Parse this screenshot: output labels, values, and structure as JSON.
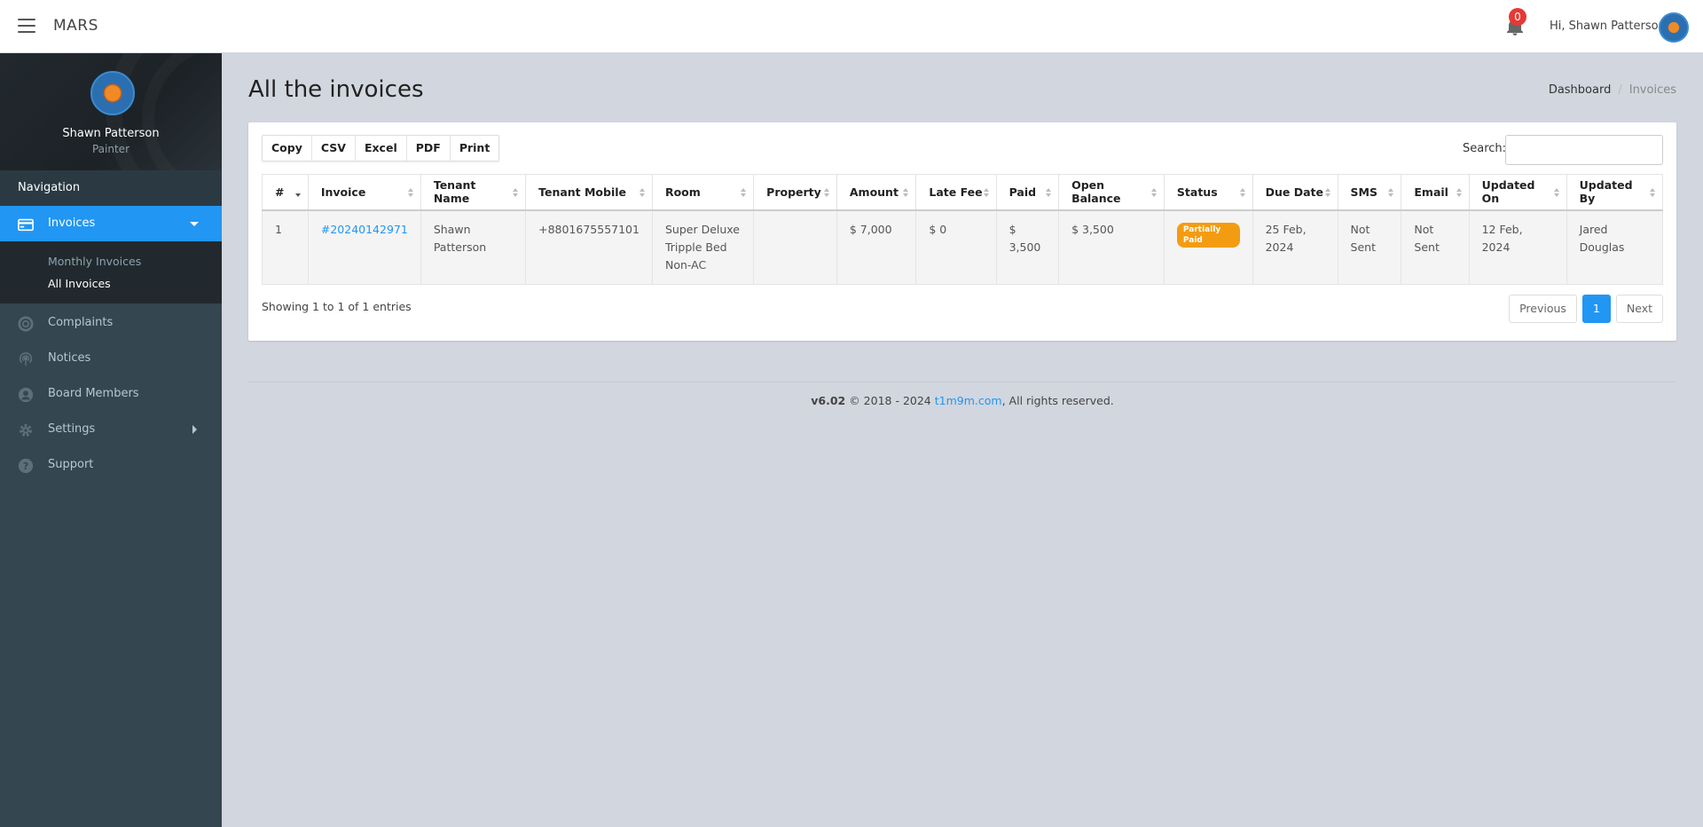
{
  "header": {
    "brand": "MARS",
    "notification_count": "0",
    "greeting": "Hi, Shawn Patterson"
  },
  "sidebar": {
    "user_name": "Shawn Patterson",
    "user_role": "Painter",
    "nav_header": "Navigation",
    "items": [
      {
        "label": "Invoices",
        "icon": "credit-card-icon"
      },
      {
        "label": "Complaints",
        "icon": "life-ring-icon"
      },
      {
        "label": "Notices",
        "icon": "broadcast-icon"
      },
      {
        "label": "Board Members",
        "icon": "user-circle-icon"
      },
      {
        "label": "Settings",
        "icon": "gear-icon"
      },
      {
        "label": "Support",
        "icon": "question-circle-icon"
      }
    ],
    "sub_items": [
      {
        "label": "Monthly Invoices"
      },
      {
        "label": "All Invoices"
      }
    ]
  },
  "page": {
    "title": "All the invoices",
    "breadcrumb": [
      "Dashboard",
      "Invoices"
    ]
  },
  "toolbar": {
    "buttons": [
      "Copy",
      "CSV",
      "Excel",
      "PDF",
      "Print"
    ],
    "search_label": "Search:",
    "search_value": ""
  },
  "table": {
    "columns": [
      "#",
      "Invoice",
      "Tenant Name",
      "Tenant Mobile",
      "Room",
      "Property",
      "Amount",
      "Late Fee",
      "Paid",
      "Open Balance",
      "Status",
      "Due Date",
      "SMS",
      "Email",
      "Updated On",
      "Updated By"
    ],
    "rows": [
      {
        "num": "1",
        "invoice": "#20240142971",
        "tenant_name": "Shawn Patterson",
        "tenant_mobile": "+8801675557101",
        "room": "Super Deluxe Tripple Bed Non-AC",
        "property": "",
        "amount": "$ 7,000",
        "late_fee": "$ 0",
        "paid": "$ 3,500",
        "open_balance": "$ 3,500",
        "status": "Partially Paid",
        "due_date": "25 Feb, 2024",
        "sms": "Not Sent",
        "email": "Not Sent",
        "updated_on": "12 Feb, 2024",
        "updated_by": "Jared Douglas"
      }
    ]
  },
  "pagination": {
    "info": "Showing 1 to 1 of 1 entries",
    "previous": "Previous",
    "current": "1",
    "next": "Next"
  },
  "footer": {
    "version": "v6.02",
    "copyright": " © 2018 - 2024 ",
    "link": "t1m9m.com",
    "rights": ", All rights reserved."
  },
  "colors": {
    "accent": "#2196f3",
    "sidebar": "#34464f",
    "status_partial": "#f39c12",
    "badge": "#e53935"
  }
}
